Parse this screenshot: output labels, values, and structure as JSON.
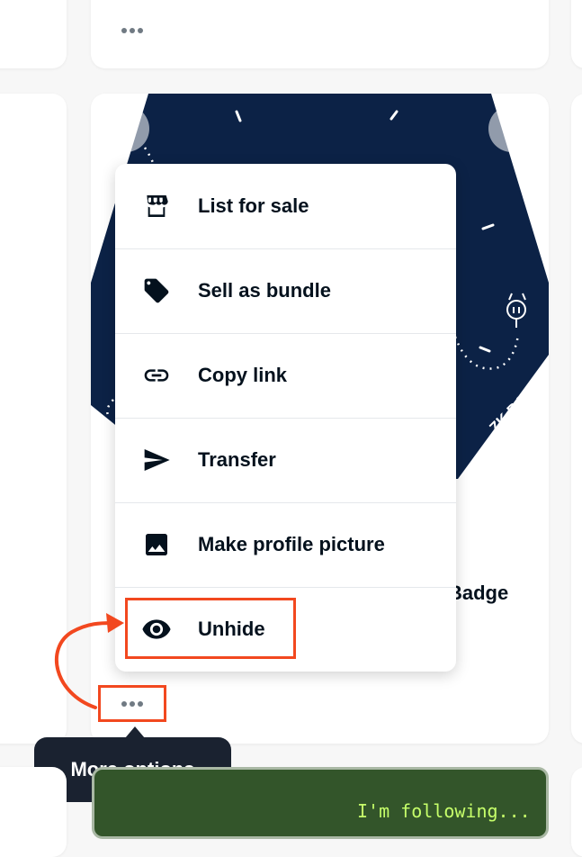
{
  "menu": {
    "items": [
      {
        "label": "List for sale",
        "icon": "storefront-icon"
      },
      {
        "label": "Sell as bundle",
        "icon": "tag-icon"
      },
      {
        "label": "Copy link",
        "icon": "link-icon"
      },
      {
        "label": "Transfer",
        "icon": "send-icon"
      },
      {
        "label": "Make profile picture",
        "icon": "image-icon"
      },
      {
        "label": "Unhide",
        "icon": "eye-icon"
      }
    ]
  },
  "nft_card": {
    "partial_title": "Badge",
    "badge_text": "ZK BADGE"
  },
  "tooltip": {
    "text": "More options"
  },
  "bottom_card": {
    "text": "I'm following..."
  },
  "colors": {
    "highlight": "#f2481f",
    "nft_background": "#0c2246",
    "tooltip_background": "#1a2230",
    "green_card": "#33552a",
    "green_text": "#c6ff6a"
  }
}
